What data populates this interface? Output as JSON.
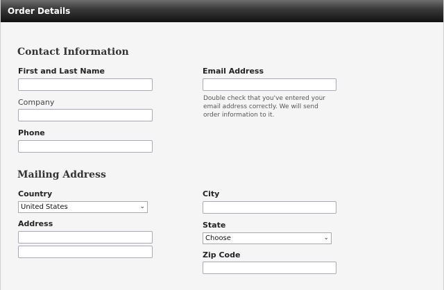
{
  "window": {
    "title": "Order Details"
  },
  "contact": {
    "heading": "Contact Information",
    "name_label": "First and Last Name",
    "company_label": "Company",
    "phone_label": "Phone",
    "email_label": "Email Address",
    "email_help": "Double check that you've entered your email address correctly. We will send order information to it."
  },
  "mailing": {
    "heading": "Mailing Address",
    "country_label": "Country",
    "country_value": "United States",
    "address_label": "Address",
    "city_label": "City",
    "state_label": "State",
    "state_value": "Choose",
    "zip_label": "Zip Code"
  }
}
